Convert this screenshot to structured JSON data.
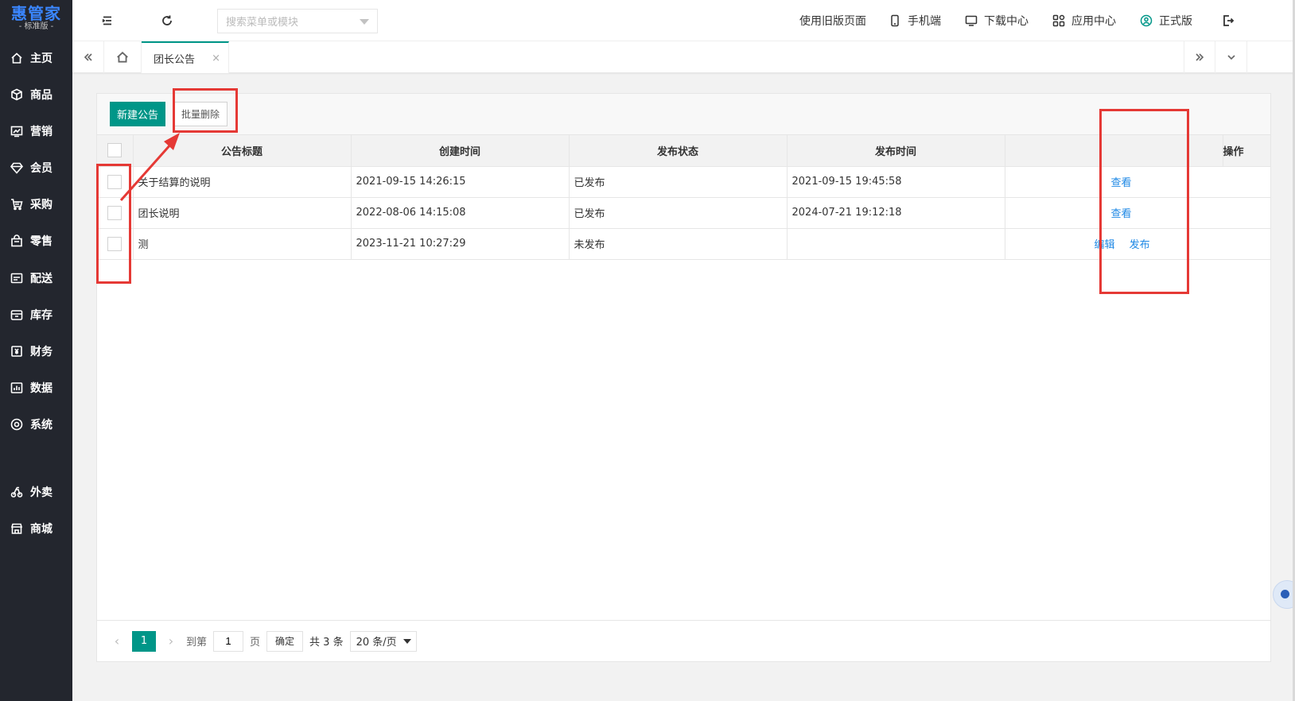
{
  "sidebar": {
    "logo_main": "惠管家",
    "logo_sub": "- 标准版 -",
    "items": [
      {
        "label": "主页",
        "icon": "home-icon"
      },
      {
        "label": "商品",
        "icon": "box-icon"
      },
      {
        "label": "营销",
        "icon": "chart-icon"
      },
      {
        "label": "会员",
        "icon": "diamond-icon"
      },
      {
        "label": "采购",
        "icon": "cart-icon"
      },
      {
        "label": "零售",
        "icon": "bag-icon"
      },
      {
        "label": "配送",
        "icon": "truck-icon"
      },
      {
        "label": "库存",
        "icon": "warehouse-icon"
      },
      {
        "label": "财务",
        "icon": "money-icon"
      },
      {
        "label": "数据",
        "icon": "bar-chart-icon"
      },
      {
        "label": "系统",
        "icon": "settings-icon"
      },
      {
        "label": "外卖",
        "icon": "bike-icon"
      },
      {
        "label": "商城",
        "icon": "shop-icon"
      }
    ]
  },
  "header": {
    "search_placeholder": "搜索菜单或模块",
    "old_page": "使用旧版页面",
    "mobile": "手机端",
    "download": "下载中心",
    "app_center": "应用中心",
    "version": "正式版"
  },
  "tabs": {
    "active_label": "团长公告",
    "close": "×"
  },
  "toolbar": {
    "new_label": "新建公告",
    "batch_delete_label": "批量删除"
  },
  "table": {
    "columns": [
      "公告标题",
      "创建时间",
      "发布状态",
      "发布时间",
      "",
      "操作"
    ],
    "rows": [
      {
        "title": "关于结算的说明",
        "created": "2021-09-15 14:26:15",
        "status": "已发布",
        "published": "2021-09-15 19:45:58",
        "ops": [
          "查看"
        ]
      },
      {
        "title": "团长说明",
        "created": "2022-08-06 14:15:08",
        "status": "已发布",
        "published": "2024-07-21 19:12:18",
        "ops": [
          "查看"
        ]
      },
      {
        "title": "测",
        "created": "2023-11-21 10:27:29",
        "status": "未发布",
        "published": "",
        "ops": [
          "编辑",
          "发布"
        ]
      }
    ]
  },
  "pager": {
    "current": "1",
    "goto_label": "到第",
    "page_input": "1",
    "page_unit": "页",
    "confirm": "确定",
    "total": "共 3 条",
    "page_size": "20 条/页"
  },
  "colors": {
    "sidebar_bg": "#23262e",
    "accent": "#009688",
    "link": "#1e88e5",
    "annotation": "#e53935"
  }
}
